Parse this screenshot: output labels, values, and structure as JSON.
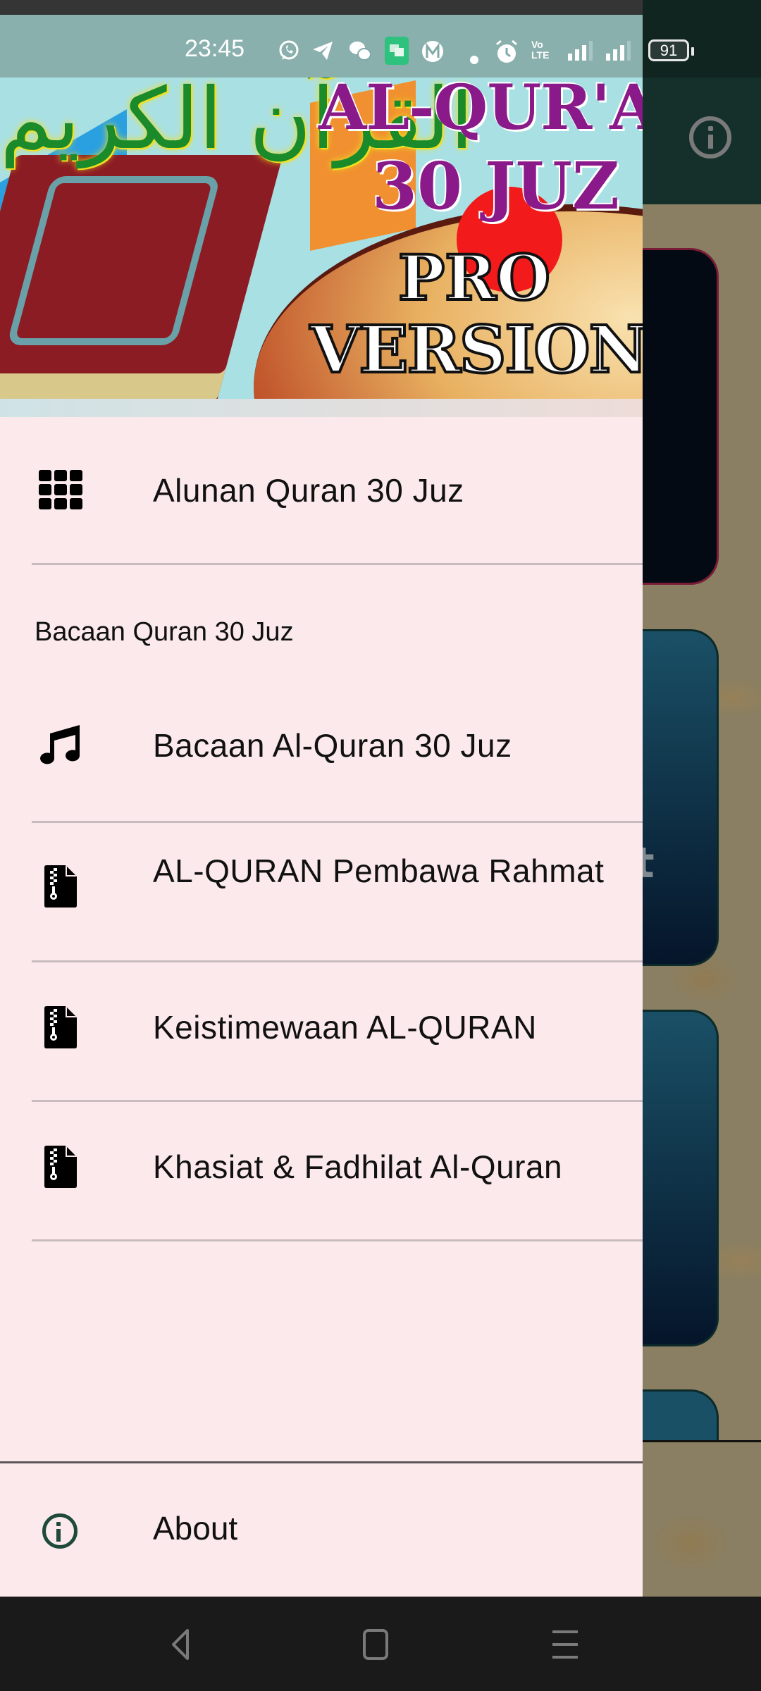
{
  "status_bar": {
    "time": "23:45",
    "notification_icons": [
      "whatsapp-icon",
      "telegram-icon",
      "wechat-icon",
      "chat-app-icon",
      "m-app-icon",
      "dot-icon"
    ],
    "system_icons": [
      "alarm-icon",
      "volte-lte-icon",
      "signal-sim1-icon",
      "signal-sim2-icon"
    ],
    "network_label_top": "Vo",
    "network_label_bottom": "LTE",
    "battery": "91"
  },
  "drawer": {
    "banner": {
      "arabic_title": "القرآن الكريم",
      "title_line1": "AL-QUR'AN",
      "title_line2": "30  JUZ",
      "title_line3": "PRO",
      "title_line4": "VERSION"
    },
    "items": [
      {
        "icon": "grid-icon",
        "label": "Alunan Quran 30 Juz"
      }
    ],
    "section_header": "Bacaan Quran 30 Juz",
    "section_items": [
      {
        "icon": "music-note-icon",
        "label": "Bacaan Al-Quran 30 Juz"
      },
      {
        "icon": "zip-file-icon",
        "label": "AL-QURAN Pembawa Rahmat"
      },
      {
        "icon": "zip-file-icon",
        "label": "Keistimewaan AL-QURAN"
      },
      {
        "icon": "zip-file-icon",
        "label": "Khasiat & Fadhilat Al-Quran"
      }
    ],
    "footer_item": {
      "icon": "info-icon",
      "label": "About"
    }
  },
  "background_app": {
    "partial_card_text": "t",
    "toolbar_icon": "info-icon"
  },
  "colors": {
    "drawer_bg": "#fbe9eb",
    "divider": "#c8bcbe",
    "about_icon": "#1e4a3a",
    "app_bar": "#15302a",
    "nav_bar": "#1a1a1a"
  },
  "navigation_bar": {
    "buttons": [
      "back",
      "home",
      "recents"
    ]
  }
}
